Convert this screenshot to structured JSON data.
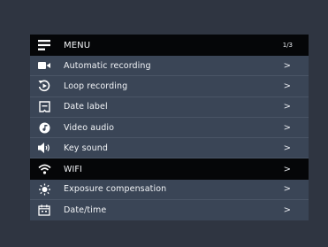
{
  "menu": {
    "title": "MENU",
    "page_indicator": "1/3",
    "items": [
      {
        "label": "Automatic recording",
        "icon": "video-camera-icon",
        "chevron": ">"
      },
      {
        "label": "Loop recording",
        "icon": "loop-play-icon",
        "chevron": ">"
      },
      {
        "label": "Date label",
        "icon": "date-label-icon",
        "chevron": ">"
      },
      {
        "label": "Video audio",
        "icon": "audio-disc-icon",
        "chevron": ">"
      },
      {
        "label": "Key sound",
        "icon": "speaker-icon",
        "chevron": ">"
      },
      {
        "label": "WIFI",
        "icon": "wifi-icon",
        "chevron": ">",
        "selected": true
      },
      {
        "label": "Exposure compensation",
        "icon": "exposure-icon",
        "chevron": ">"
      },
      {
        "label": "Date/time",
        "icon": "calendar-icon",
        "chevron": ">"
      }
    ]
  },
  "colors": {
    "background": "#2f3541",
    "panel": "#3a4556",
    "header": "#050608",
    "selected": "#050608",
    "text": "#f2f4f7"
  }
}
